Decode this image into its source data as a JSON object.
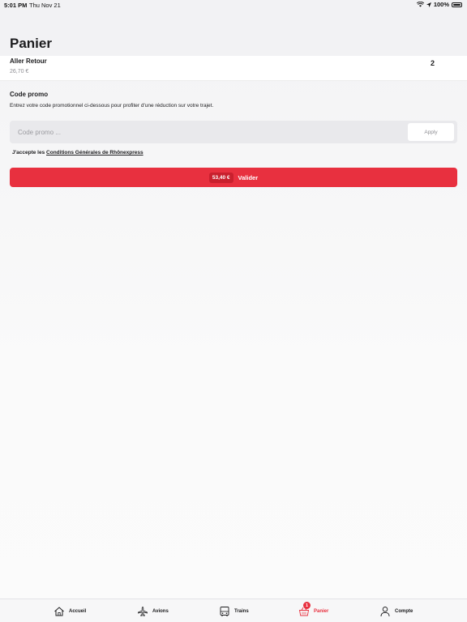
{
  "status_bar": {
    "time": "5:01 PM",
    "date": "Thu Nov 21",
    "battery": "100%"
  },
  "page": {
    "title": "Panier"
  },
  "cart": {
    "item_name": "Aller Retour",
    "item_price": "26,70 €",
    "quantity": "2"
  },
  "promo": {
    "title": "Code promo",
    "description": "Entrez votre code promotionnel ci-dessous pour profiter d'une réduction sur votre trajet.",
    "placeholder": "Code promo ...",
    "apply_label": "Apply"
  },
  "terms": {
    "prefix": "J'accepte les ",
    "link": "Conditions Générales de Rhônexpress"
  },
  "checkout": {
    "total": "53,40 €",
    "validate_label": "Valider"
  },
  "tabs": [
    {
      "label": "Accueil",
      "icon": "home-icon"
    },
    {
      "label": "Avions",
      "icon": "plane-icon"
    },
    {
      "label": "Trains",
      "icon": "train-icon"
    },
    {
      "label": "Panier",
      "icon": "basket-icon",
      "badge": "1"
    },
    {
      "label": "Compte",
      "icon": "user-icon"
    }
  ],
  "colors": {
    "accent": "#e8303f",
    "accent_dark": "#c9202e"
  }
}
